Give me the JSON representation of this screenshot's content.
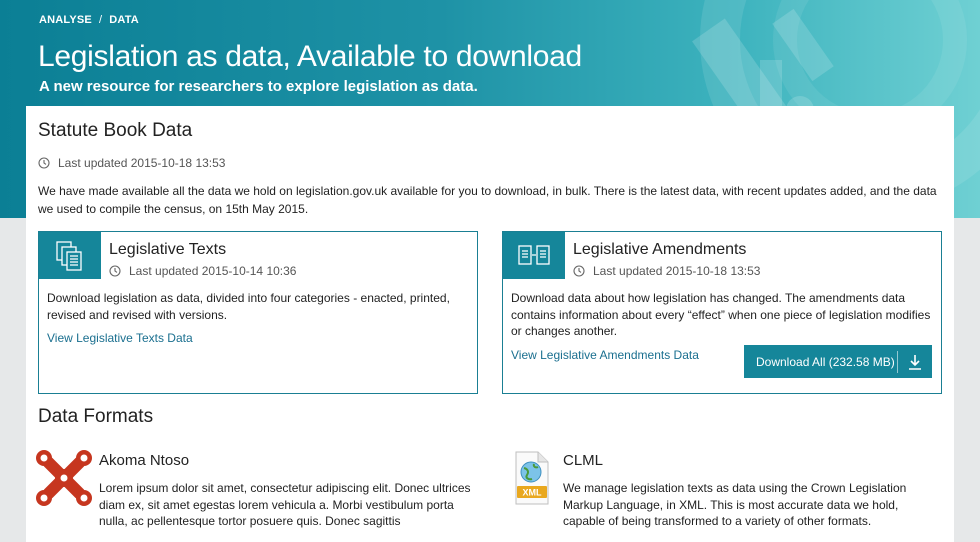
{
  "breadcrumb": {
    "items": [
      "ANALYSE",
      "DATA"
    ],
    "separator": "/"
  },
  "hero": {
    "title": "Legislation as data, Available to download",
    "subtitle": "A new resource for researchers to explore legislation as data."
  },
  "statute": {
    "title": "Statute Book Data",
    "updated": "Last updated 2015-10-18 13:53",
    "description": "We have made available all the data we hold on legislation.gov.uk available for you to download, in bulk. There is the latest data, with recent updates added, and the data we used to compile the census, on 15th May 2015."
  },
  "cards": [
    {
      "title": "Legislative Texts",
      "updated": "Last updated 2015-10-14 10:36",
      "description": "Download legislation as data, divided into four categories - enacted, printed, revised and revised with versions.",
      "link": "View Legislative Texts Data",
      "icon": "documents-stack-icon"
    },
    {
      "title": "Legislative Amendments",
      "updated": "Last updated 2015-10-18 13:53",
      "description": "Download data about how legislation has changed. The amendments data contains information about every “effect” when one piece of legislation modifies or changes another.",
      "link": "View Legislative Amendments Data",
      "button": "Download All (232.58 MB)",
      "icon": "document-compare-icon"
    }
  ],
  "formats": {
    "title": "Data Formats",
    "items": [
      {
        "name": "Akoma Ntoso",
        "description": "Lorem ipsum dolor sit amet, consectetur adipiscing elit. Donec ultrices diam ex, sit amet egestas lorem vehicula a. Morbi vestibulum porta nulla, ac pellentesque tortor posuere quis. Donec sagittis",
        "logo": "akoma-ntoso-logo"
      },
      {
        "name": "CLML",
        "description": "We manage legislation texts as data using the Crown Legislation Markup Language, in XML. This is most accurate data we hold, capable of being transformed to a variety of other formats.",
        "logo": "xml-file-icon",
        "logo_text": "XML"
      }
    ]
  },
  "colors": {
    "teal": "#15869a",
    "link": "#1a6f8f",
    "akoma_red": "#c6361f"
  }
}
